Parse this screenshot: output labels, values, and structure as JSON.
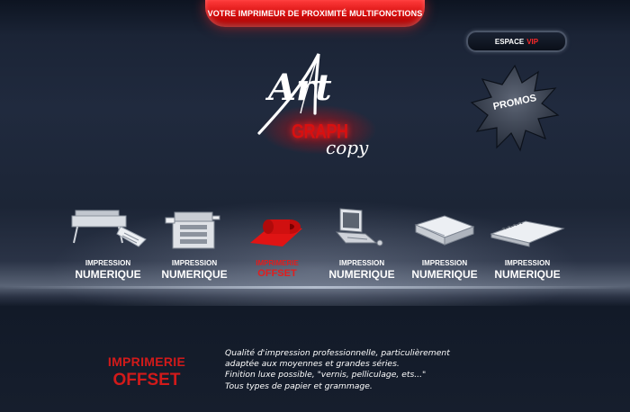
{
  "header": {
    "banner_text": "VOTRE IMPRIMEUR DE PROXIMITÉ MULTIFONCTIONS",
    "vip_button": {
      "label": "ESPACE",
      "accent": "VIP"
    },
    "promo_label": "PROMOS"
  },
  "logo": {
    "art": "Art",
    "graph": "GRAPH",
    "copy": "copy"
  },
  "products": [
    {
      "line1": "IMPRESSION",
      "line2": "NUMERIQUE",
      "icon": "wide-format-printer-icon"
    },
    {
      "line1": "IMPRESSION",
      "line2": "NUMERIQUE",
      "icon": "copier-machine-icon"
    },
    {
      "line1": "IMPRIMERIE",
      "line2": "OFFSET",
      "icon": "offset-roll-icon",
      "active": true
    },
    {
      "line1": "IMPRESSION",
      "line2": "NUMERIQUE",
      "icon": "laptop-icon"
    },
    {
      "line1": "IMPRESSION",
      "line2": "NUMERIQUE",
      "icon": "binder-icon"
    },
    {
      "line1": "IMPRESSION",
      "line2": "NUMERIQUE",
      "icon": "spiral-notebook-icon"
    }
  ],
  "section": {
    "title_line1": "IMPRIMERIE",
    "title_line2": "OFFSET",
    "description": [
      "Qualité d'impression professionnelle, particulièrement",
      "adaptée aux moyennes et grandes séries.",
      "Finition luxe possible, \"vernis, pelliculage, ets...\"",
      "Tous types de papier et grammage."
    ]
  },
  "colors": {
    "accent_red": "#d21a1a",
    "background": "#141c2a",
    "banner_red": "#e01010"
  }
}
